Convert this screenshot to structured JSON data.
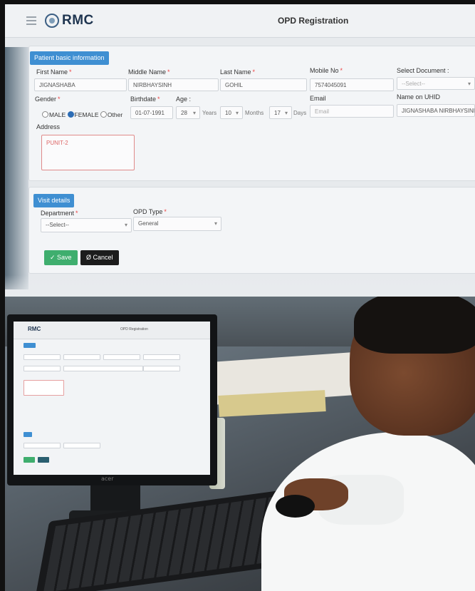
{
  "app": {
    "brand": "RMC",
    "page_title": "OPD Registration"
  },
  "patient_section": {
    "tab_label": "Patient basic information",
    "first_name": {
      "label": "First Name",
      "value": "JIGNASHABA"
    },
    "middle_name": {
      "label": "Middle Name",
      "value": "NIRBHAYSINH"
    },
    "last_name": {
      "label": "Last Name",
      "value": "GOHIL"
    },
    "mobile": {
      "label": "Mobile No",
      "value": "7574045091"
    },
    "document": {
      "label": "Select Document :",
      "value": "--Select--"
    },
    "gender": {
      "label": "Gender",
      "options": [
        "MALE",
        "FEMALE",
        "Other"
      ],
      "selected": "FEMALE"
    },
    "birthdate": {
      "label": "Birthdate",
      "value": "01-07-1991"
    },
    "age": {
      "label": "Age :",
      "years_value": "28",
      "years_label": "Years",
      "months_value": "10",
      "months_label": "Months",
      "days_value": "17",
      "days_label": "Days"
    },
    "email": {
      "label": "Email",
      "placeholder": "Email"
    },
    "uhid_name": {
      "label": "Name on UHID",
      "value": "JIGNASHABA NIRBHAYSINH"
    },
    "address": {
      "label": "Address",
      "value": "PUNIT-2"
    },
    "required_mark": "*"
  },
  "visit_section": {
    "tab_label": "Visit details",
    "department": {
      "label": "Department",
      "value": "--Select--"
    },
    "opd_type": {
      "label": "OPD Type",
      "value": "General"
    }
  },
  "actions": {
    "save_label": "✓ Save",
    "cancel_label": "Ø Cancel"
  },
  "colors": {
    "accent": "#3f8fd2",
    "save": "#3fae6e",
    "cancel": "#1c1c1c",
    "brand": "#1f3550"
  },
  "monitor": {
    "brand_label": "acer",
    "mini_brand": "RMC",
    "mini_title": "OPD Registration"
  }
}
